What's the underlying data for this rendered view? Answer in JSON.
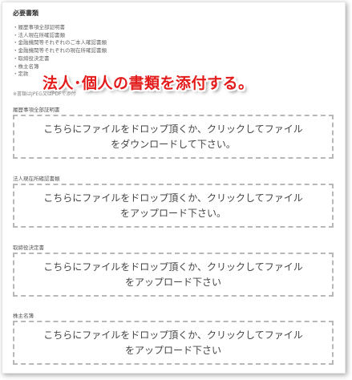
{
  "heading": "必要書類",
  "required_documents": [
    "履歴事項全部証明書",
    "法人現在所確認書類",
    "金融機関等それぞれのご本人確認書類",
    "金融機関等それぞれの現在所確認書類",
    "取締役決定書",
    "株主名簿",
    "定款"
  ],
  "note": "※書類はJPEG又はPDFで添付",
  "overlay_title": "法人･個人の書類を添付する。",
  "upload_sections": [
    {
      "label": "履歴事項全部証明書",
      "dropzone_text": "こちらにファイルをドロップ頂くか、クリックしてファイルをダウンロードして下さい。"
    },
    {
      "label": "法人現在所確認書類",
      "dropzone_text": "こちらにファイルをドロップ頂くか、クリックしてファイルをアップロード下さい。"
    },
    {
      "label": "取締役決定書",
      "dropzone_text": "こちらにファイルをドロップ頂くか、クリックしてファイルをアップロード下さい"
    },
    {
      "label": "株主名簿",
      "dropzone_text": "こちらにファイルをドロップ頂くか、クリックしてファイルをアップロード下さい"
    }
  ],
  "colors": {
    "overlay_text": "#e41b1b",
    "dropzone_border": "#b8b8b8"
  }
}
